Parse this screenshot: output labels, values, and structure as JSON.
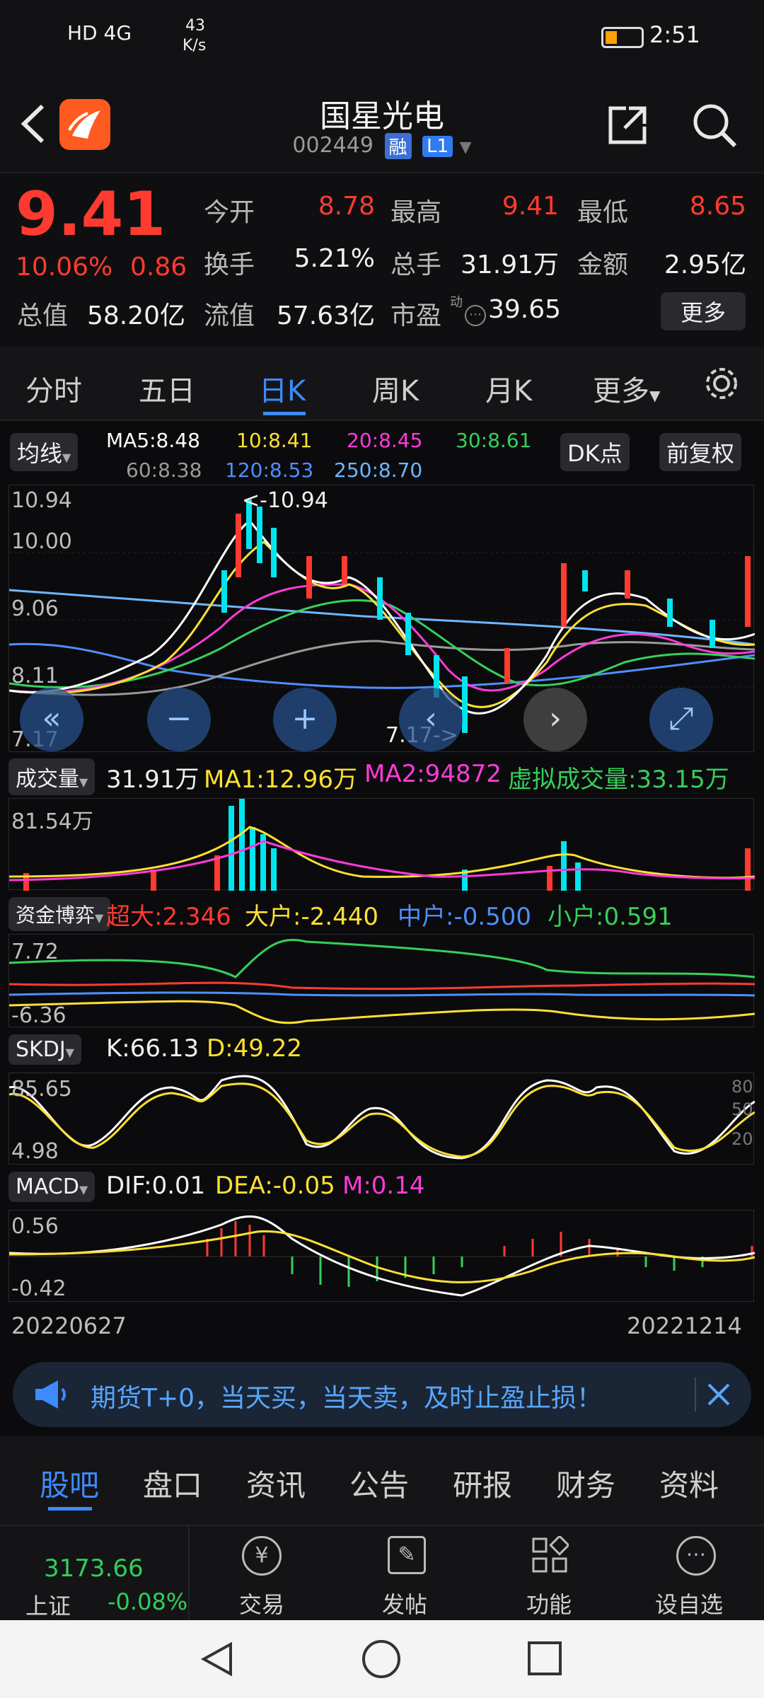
{
  "status_bar": {
    "left_icons": "HD 4G",
    "net_speed_top": "43",
    "net_speed_bottom": "K/s",
    "time": "2:51"
  },
  "header": {
    "title": "国星光电",
    "code": "002449",
    "badge_rong": "融",
    "badge_level": "L1"
  },
  "quote": {
    "price": "9.41",
    "change_pct": "10.06%",
    "change_abs": "0.86",
    "open_label": "今开",
    "open": "8.78",
    "high_label": "最高",
    "high": "9.41",
    "low_label": "最低",
    "low": "8.65",
    "turnover_label": "换手",
    "turnover": "5.21%",
    "volume_label": "总手",
    "volume": "31.91万",
    "amount_label": "金额",
    "amount": "2.95亿",
    "mktcap_label": "总值",
    "mktcap": "58.20亿",
    "float_label": "流值",
    "float": "57.63亿",
    "pe_label": "市盈",
    "pe_sup": "动",
    "pe": "39.65",
    "more_button": "更多"
  },
  "tabs": [
    "分时",
    "五日",
    "日K",
    "周K",
    "月K",
    "更多"
  ],
  "active_tab": "日K",
  "kline": {
    "ma_button": "均线",
    "ma5": "MA5:8.48",
    "ma10": "10:8.41",
    "ma20": "20:8.45",
    "ma30": "30:8.61",
    "ma60": "60:8.38",
    "ma120": "120:8.53",
    "ma250": "250:8.70",
    "dk_button": "DK点",
    "fq_button": "前复权",
    "y_top": "10.94",
    "y_mid1": "10.00",
    "y_mid2": "9.06",
    "y_mid3": "8.11",
    "y_bottom": "7.17",
    "max_marker": "<-10.94",
    "min_marker": "7.17->"
  },
  "volume_panel": {
    "button": "成交量",
    "vol": "31.91万",
    "ma1": "MA1:12.96万",
    "ma2": "MA2:94872",
    "virtual": "虚拟成交量:33.15万",
    "y_top": "81.54万"
  },
  "capital_panel": {
    "button": "资金博弈",
    "super": "超大:2.346",
    "large": "大户:-2.440",
    "medium": "中户:-0.500",
    "small": "小户:0.591",
    "y_top": "7.72",
    "y_bottom": "-6.36"
  },
  "skdj_panel": {
    "button": "SKDJ",
    "k": "K:66.13",
    "d": "D:49.22",
    "y_top": "85.65",
    "y_bottom": "4.98",
    "ref_80": "80",
    "ref_50": "50",
    "ref_20": "20"
  },
  "macd_panel": {
    "button": "MACD",
    "dif": "DIF:0.01",
    "dea": "DEA:-0.05",
    "m": "M:0.14",
    "y_top": "0.56",
    "y_bottom": "-0.42"
  },
  "date_start": "20220627",
  "date_end": "20221214",
  "banner": {
    "text": "期货T+0，当天买，当天卖，及时止盈止损！"
  },
  "section_tabs": [
    "股吧",
    "盘口",
    "资讯",
    "公告",
    "研报",
    "财务",
    "资料"
  ],
  "active_section": "股吧",
  "toolbar": {
    "index_value": "3173.66",
    "index_name": "上证",
    "index_change": "-0.08%",
    "trade": "交易",
    "post": "发帖",
    "function": "功能",
    "watchlist": "设自选"
  },
  "colors": {
    "up": "#ff3b30",
    "down": "#2fcf5a",
    "accent": "#3d8bff",
    "ma5": "#ffffff",
    "ma10": "#ffe033",
    "ma20": "#ff3bd9",
    "ma30": "#36d05a",
    "ma60": "#9a9a9a",
    "ma120": "#4f8fff",
    "ma250": "#6fb7ff"
  }
}
